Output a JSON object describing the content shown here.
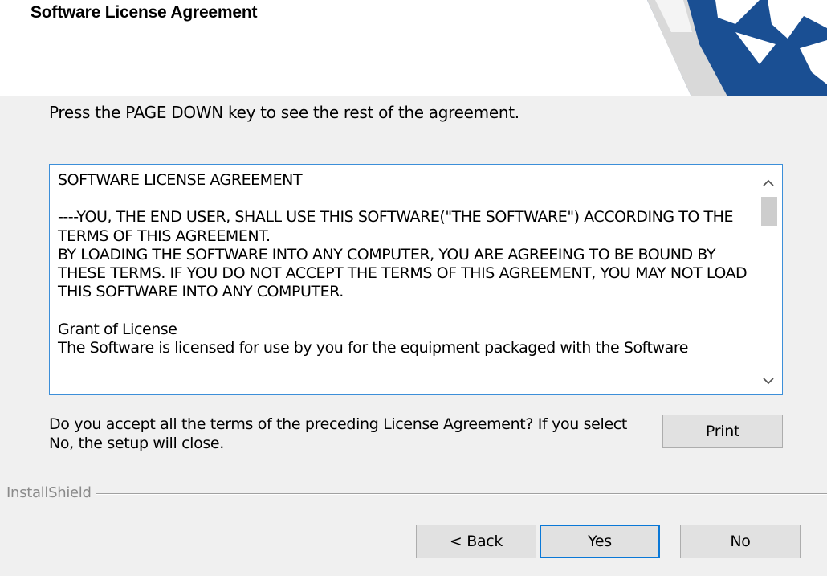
{
  "header": {
    "title": "Software License Agreement",
    "logo_icon": "installshield-logo-icon"
  },
  "instruction": "Press the PAGE DOWN key to see the rest of the agreement.",
  "license": {
    "text": "SOFTWARE LICENSE AGREEMENT\n\n----YOU, THE END USER, SHALL USE THIS SOFTWARE(\"THE SOFTWARE\") ACCORDING TO THE TERMS OF THIS AGREEMENT.\nBY LOADING THE SOFTWARE INTO ANY COMPUTER, YOU ARE AGREEING TO BE BOUND BY THESE TERMS. IF YOU DO NOT ACCEPT THE TERMS OF THIS AGREEMENT, YOU MAY NOT LOAD THIS SOFTWARE INTO ANY COMPUTER.\n\nGrant of License\nThe Software is licensed for use by you for the equipment packaged with the Software",
    "scroll_up_icon": "chevron-up-icon",
    "scroll_down_icon": "chevron-down-icon"
  },
  "question": "Do you accept all the terms of the preceding License Agreement?  If you select No,  the setup will close.",
  "buttons": {
    "print": "Print",
    "back": "< Back",
    "yes": "Yes",
    "no": "No"
  },
  "brand": "InstallShield",
  "colors": {
    "accent_border": "#3c8fd9",
    "default_button_border": "#0a78d7",
    "logo_blue": "#1a4f93"
  }
}
